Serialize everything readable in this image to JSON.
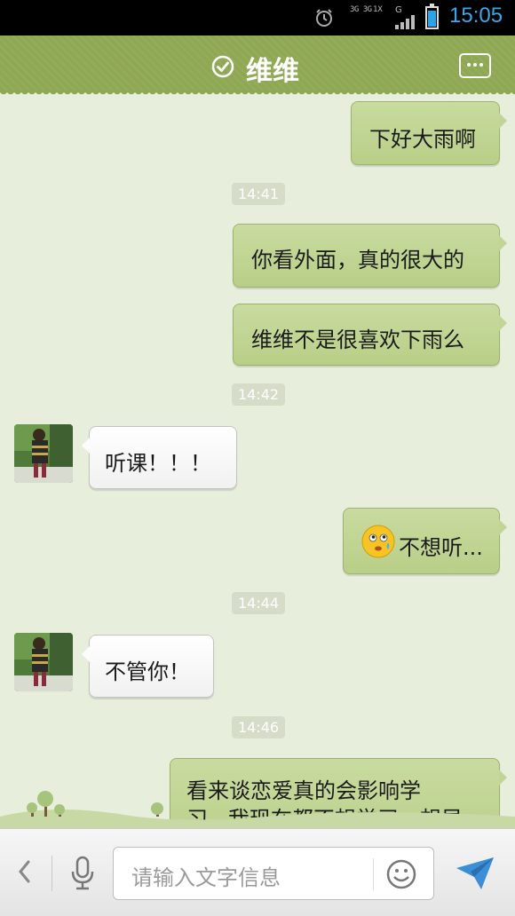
{
  "status_bar": {
    "time": "15:05",
    "net_a": "3G 3G",
    "net_b": "1X",
    "net_g": "G"
  },
  "header": {
    "title": "维维"
  },
  "messages": [
    {
      "side": "right",
      "text": "下好大雨啊"
    },
    {
      "type": "timestamp",
      "text": "14:41"
    },
    {
      "side": "right",
      "text": "你看外面，真的很大的"
    },
    {
      "side": "right",
      "text": "维维不是很喜欢下雨么"
    },
    {
      "type": "timestamp",
      "text": "14:42"
    },
    {
      "side": "left",
      "text": "听课！！！"
    },
    {
      "side": "right",
      "text": "不想听...",
      "emoji": "sweat-smile-emoji"
    },
    {
      "type": "timestamp",
      "text": "14:44"
    },
    {
      "side": "left",
      "text": "不管你！"
    },
    {
      "type": "timestamp",
      "text": "14:46"
    },
    {
      "side": "right",
      "text_line1": "看来谈恋爱真的会影响学",
      "text_line2": "习...我现在都不想学习，想早"
    }
  ],
  "input": {
    "placeholder": "请输入文字信息"
  },
  "colors": {
    "header": "#8fa854",
    "bubble_right": "#c2d597",
    "bubble_left": "#ffffff",
    "timestamp_bg": "#d5ddc9",
    "chat_bg": "#e7efdc",
    "accent_blue": "#3aa8ea"
  }
}
